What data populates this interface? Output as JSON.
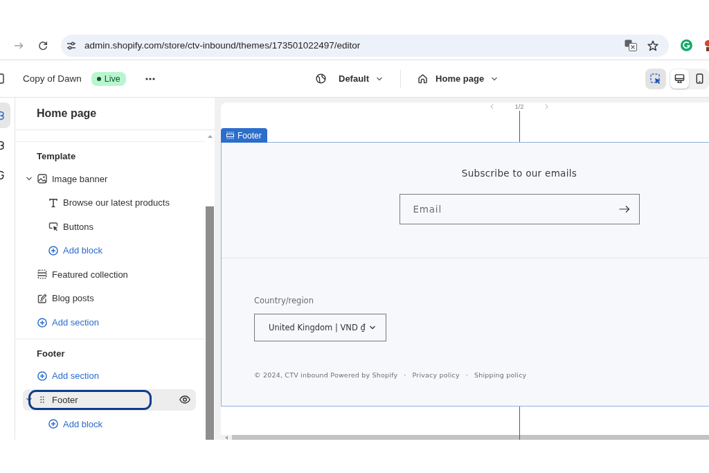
{
  "browser": {
    "url": "admin.shopify.com/store/ctv-inbound/themes/173501022497/editor"
  },
  "editor_bar": {
    "theme_name": "Copy of Dawn",
    "status": "Live",
    "market": "Default",
    "page": "Home page",
    "inspector": {
      "on": true
    },
    "devices": [
      {
        "kind": "desktop",
        "selected": true
      },
      {
        "kind": "mobile",
        "selected": false
      }
    ]
  },
  "rail": [
    {
      "selected": true
    },
    {
      "selected": false
    },
    {
      "selected": false
    }
  ],
  "sidebar": {
    "title": "Home page",
    "groups": [
      {
        "heading": "Template",
        "items": [
          {
            "kind": "banner",
            "label": "Image banner",
            "selected": false,
            "expanded": true,
            "children": [
              {
                "kind": "text",
                "label": "Browse our latest products",
                "selected": false
              },
              {
                "kind": "buttons",
                "label": "Buttons",
                "selected": false
              },
              {
                "kind": "add",
                "label": "Add block",
                "selected": false
              }
            ]
          },
          {
            "kind": "collection",
            "label": "Featured collection",
            "selected": false
          },
          {
            "kind": "blog",
            "label": "Blog posts",
            "selected": false
          },
          {
            "kind": "add",
            "label": "Add section",
            "selected": false
          }
        ]
      },
      {
        "heading": "Footer",
        "items": [
          {
            "kind": "add",
            "label": "Add section",
            "selected": false
          },
          {
            "kind": "footer",
            "label": "Footer",
            "selected": true,
            "highlighted": true,
            "expanded": true,
            "children": [
              {
                "kind": "add",
                "label": "Add block",
                "selected": false
              }
            ]
          }
        ]
      }
    ]
  },
  "preview": {
    "pagination": "1/2",
    "section_tab": "Footer",
    "newsletter_heading": "Subscribe to our emails",
    "email": {
      "placeholder": "Email"
    },
    "country_label": "Country/region",
    "country_value": "United Kingdom | VND ₫",
    "copyright": "© 2024, CTV inbound Powered by Shopify",
    "policies": [
      {
        "separator": "·",
        "label": "Privacy policy"
      },
      {
        "separator": "·",
        "label": "Shipping policy"
      }
    ]
  }
}
